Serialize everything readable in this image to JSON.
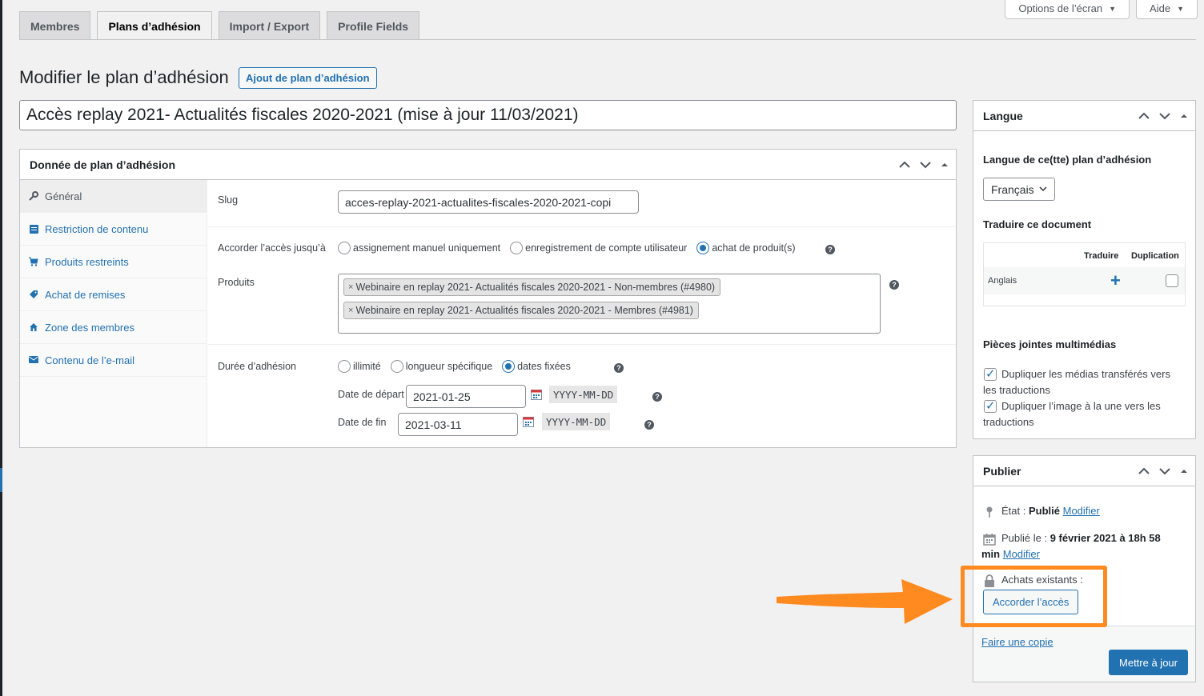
{
  "screen_meta": {
    "screen_options": "Options de l’écran",
    "help": "Aide"
  },
  "tabs": [
    {
      "label": "Membres"
    },
    {
      "label": "Plans d’adhésion"
    },
    {
      "label": "Import / Export"
    },
    {
      "label": "Profile Fields"
    }
  ],
  "page": {
    "title": "Modifier le plan d’adhésion",
    "add_new": "Ajout de plan d’adhésion",
    "post_title": "Accès replay 2021- Actualités fiscales 2020-2021 (mise à jour 11/03/2021)"
  },
  "plan_data": {
    "header": "Donnée de plan d’adhésion",
    "vtabs": [
      {
        "label": "Général"
      },
      {
        "label": "Restriction de contenu"
      },
      {
        "label": "Produits restreints"
      },
      {
        "label": "Achat de remises"
      },
      {
        "label": "Zone des membres"
      },
      {
        "label": "Contenu de l’e-mail"
      }
    ],
    "slug_label": "Slug",
    "slug_value": "acces-replay-2021-actualites-fiscales-2020-2021-copi",
    "access_label": "Accorder l’accès jusqu’à",
    "access_options": [
      {
        "label": "assignement manuel uniquement"
      },
      {
        "label": "enregistrement de compte utilisateur"
      },
      {
        "label": "achat de produit(s)"
      }
    ],
    "products_label": "Produits",
    "products": [
      {
        "label": "Webinaire en replay 2021- Actualités fiscales 2020-2021 - Non-membres (#4980)"
      },
      {
        "label": "Webinaire en replay 2021- Actualités fiscales 2020-2021 - Membres (#4981)"
      }
    ],
    "duration_label": "Durée d’adhésion",
    "duration_options": [
      {
        "label": "illimité"
      },
      {
        "label": "longueur spécifique"
      },
      {
        "label": "dates fixées"
      }
    ],
    "start_label": "Date de départ",
    "start_value": "2021-01-25",
    "end_label": "Date de fin",
    "end_value": "2021-03-11",
    "date_format": "YYYY-MM-DD",
    "chip_remove": "×",
    "help_glyph": "?"
  },
  "language_box": {
    "header": "Langue",
    "lang_label": "Langue de ce(tte) plan d’adhésion",
    "lang_value": "Français",
    "translate_label": "Traduire ce document",
    "col_translate": "Traduire",
    "col_duplicate": "Duplication",
    "row_lang": "Anglais",
    "media_label": "Pièces jointes multimédias",
    "dup_media": "Dupliquer les médias transférés vers les traductions",
    "dup_featured": "Dupliquer l’image à la une vers les traductions"
  },
  "publish_box": {
    "header": "Publier",
    "status_label": "État :",
    "status_value": "Publié",
    "edit_link": "Modifier",
    "published_label": "Publié le :",
    "published_value": "9 février 2021 à 18h 58",
    "published_value_2": "min",
    "edit_link_2": "Modifier",
    "purchases_label": "Achats existants :",
    "grant_button": "Accorder l’accès",
    "copy_link": "Faire une copie",
    "update_button": "Mettre à jour"
  },
  "colors": {
    "accent": "#2271b1",
    "annotation": "#ff8a1f"
  }
}
